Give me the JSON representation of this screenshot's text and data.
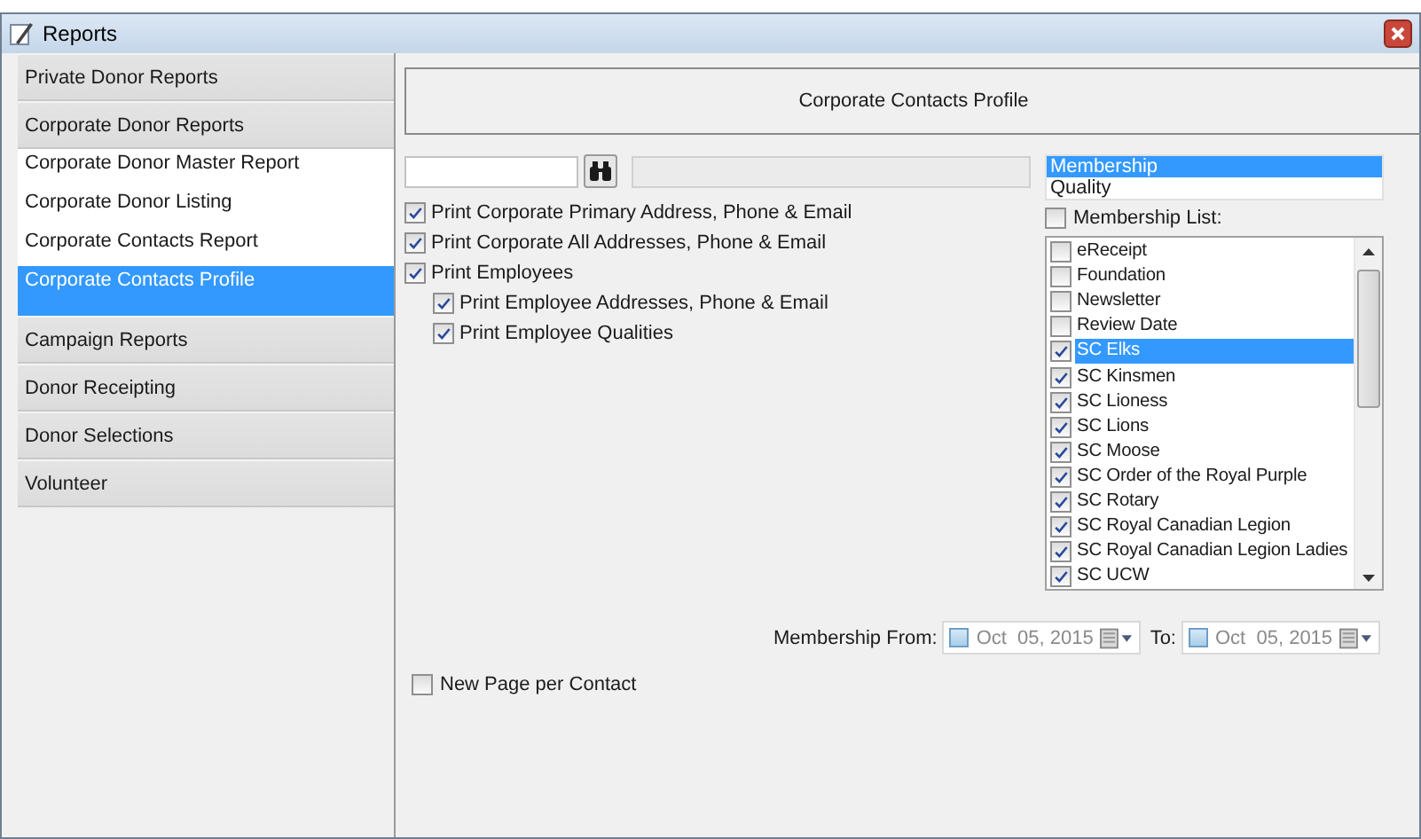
{
  "window": {
    "title": "Reports"
  },
  "sidebar": {
    "groups": [
      {
        "label": "Private Donor Reports"
      },
      {
        "label": "Corporate Donor Reports",
        "items": [
          {
            "label": "Corporate Donor Master Report",
            "selected": false
          },
          {
            "label": "Corporate Donor Listing",
            "selected": false
          },
          {
            "label": "Corporate Contacts Report",
            "selected": false
          },
          {
            "label": "Corporate Contacts Profile",
            "selected": true
          }
        ]
      },
      {
        "label": "Campaign Reports"
      },
      {
        "label": "Donor Receipting"
      },
      {
        "label": "Donor Selections"
      },
      {
        "label": "Volunteer"
      }
    ]
  },
  "header": {
    "title": "Corporate Contacts Profile"
  },
  "options": [
    {
      "label": "Print Corporate Primary Address, Phone & Email",
      "checked": true
    },
    {
      "label": "Print Corporate All Addresses, Phone & Email",
      "checked": true
    },
    {
      "label": "Print Employees",
      "checked": true,
      "children": [
        {
          "label": "Print Employee Addresses, Phone & Email",
          "checked": true
        },
        {
          "label": "Print Employee Qualities",
          "checked": true
        }
      ]
    }
  ],
  "list_type": [
    {
      "label": "Membership",
      "selected": true
    },
    {
      "label": "Quality",
      "selected": false
    }
  ],
  "membership_all": {
    "label": "Membership List:",
    "checked": false
  },
  "membership_list": [
    {
      "label": "eReceipt",
      "checked": false,
      "selected": false
    },
    {
      "label": "Foundation",
      "checked": false,
      "selected": false
    },
    {
      "label": "Newsletter",
      "checked": false,
      "selected": false
    },
    {
      "label": "Review Date",
      "checked": false,
      "selected": false
    },
    {
      "label": "SC Elks",
      "checked": true,
      "selected": true
    },
    {
      "label": "SC Kinsmen",
      "checked": true,
      "selected": false
    },
    {
      "label": "SC Lioness",
      "checked": true,
      "selected": false
    },
    {
      "label": "SC Lions",
      "checked": true,
      "selected": false
    },
    {
      "label": "SC Moose",
      "checked": true,
      "selected": false
    },
    {
      "label": "SC Order of the Royal Purple",
      "checked": true,
      "selected": false
    },
    {
      "label": "SC Rotary",
      "checked": true,
      "selected": false
    },
    {
      "label": "SC Royal Canadian Legion",
      "checked": true,
      "selected": false
    },
    {
      "label": "SC Royal Canadian Legion Ladies",
      "checked": true,
      "selected": false
    },
    {
      "label": "SC UCW",
      "checked": true,
      "selected": false
    }
  ],
  "date_range": {
    "from_label": "Membership From:",
    "from": {
      "value": "Oct  05, 2015",
      "checked": false
    },
    "to_label": "To:",
    "to": {
      "value": "Oct  05, 2015",
      "checked": false
    }
  },
  "new_page": {
    "label": "New Page per Contact",
    "checked": false
  }
}
